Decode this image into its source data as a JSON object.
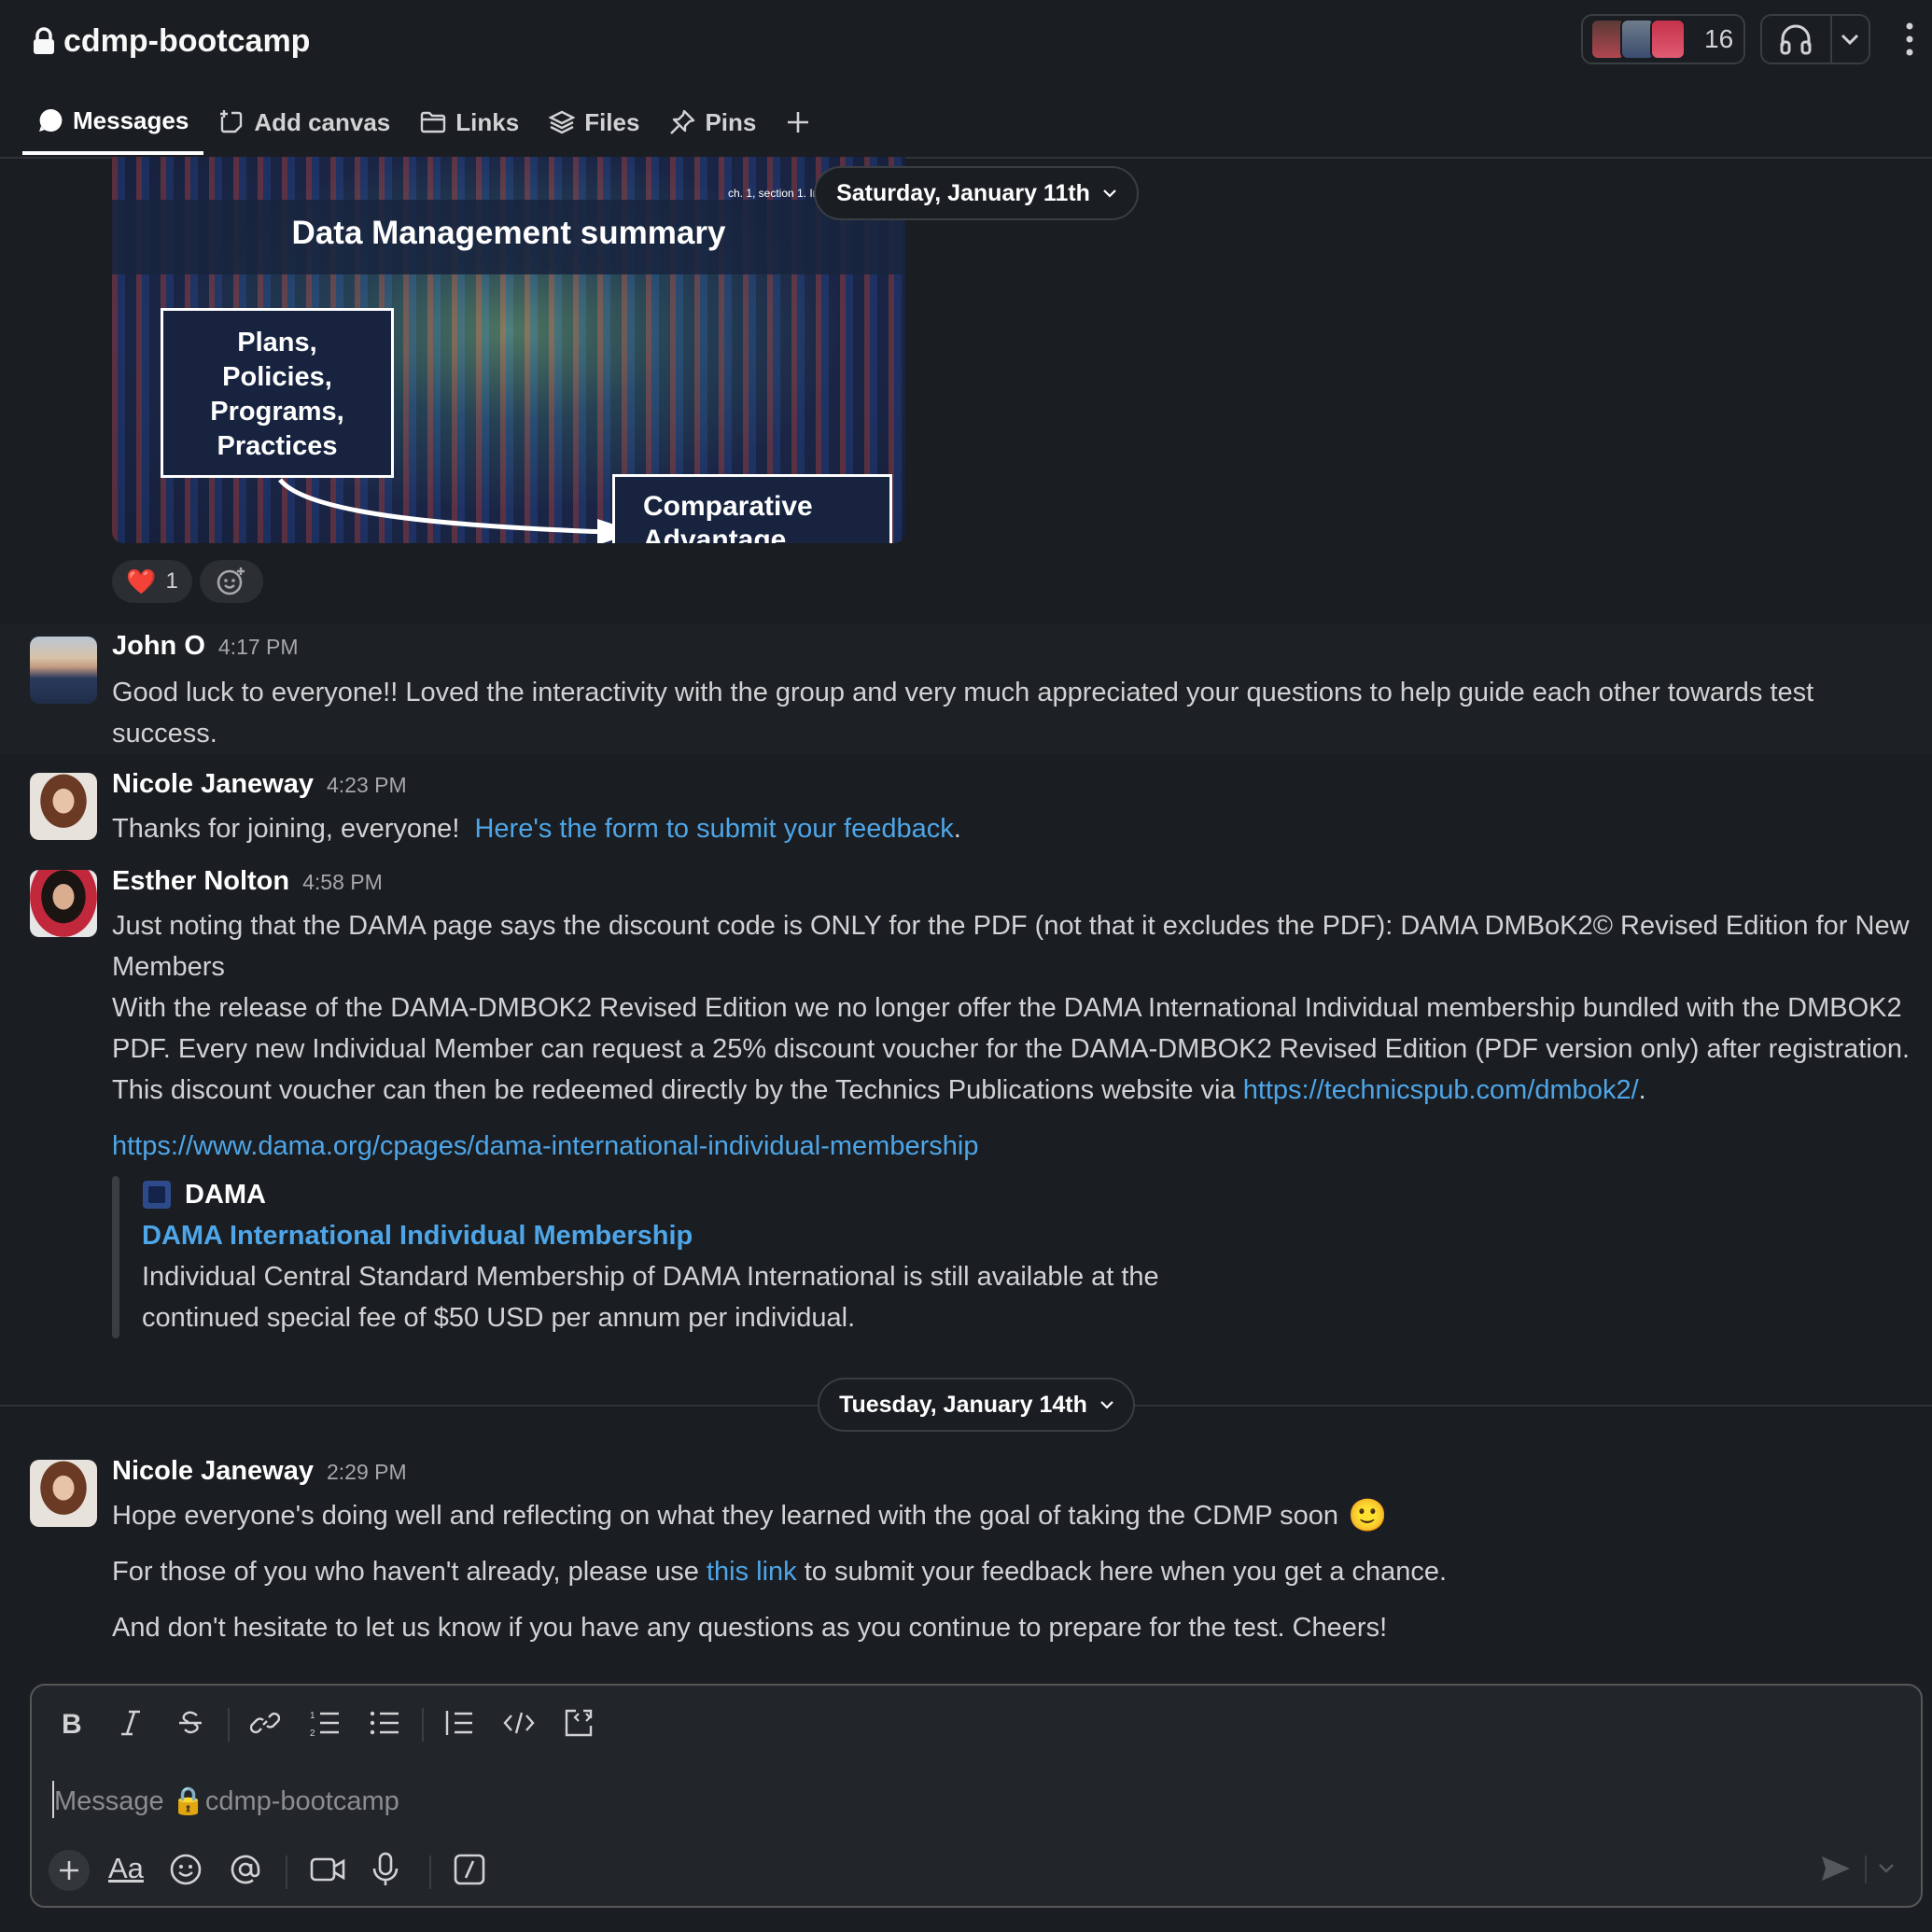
{
  "header": {
    "channel_name": "cdmp-bootcamp",
    "member_count": "16"
  },
  "tabs": [
    {
      "label": "Messages",
      "icon": "message-bubble-icon",
      "active": true
    },
    {
      "label": "Add canvas",
      "icon": "canvas-icon"
    },
    {
      "label": "Links",
      "icon": "folder-icon"
    },
    {
      "label": "Files",
      "icon": "layers-icon"
    },
    {
      "label": "Pins",
      "icon": "pin-icon"
    }
  ],
  "image_attachment": {
    "title": "Data Management summary",
    "corner_text": "ch. 1, section 1. In",
    "box1": [
      "Plans,",
      "Policies,",
      "Programs,",
      "Practices"
    ],
    "box2": "Comparative Advantage"
  },
  "reactions": [
    {
      "emoji": "❤️",
      "count": "1"
    }
  ],
  "date_dividers": [
    "Saturday, January 11th",
    "Tuesday, January 14th"
  ],
  "messages": [
    {
      "author": "John O",
      "time": "4:17 PM",
      "text": "Good luck to everyone!!  Loved the interactivity with the group and very much appreciated your questions to help guide each other towards test success."
    },
    {
      "author": "Nicole Janeway",
      "time": "4:23 PM",
      "text": "Thanks for joining, everyone!  ",
      "link": "Here's the form to submit your feedback",
      "after": "."
    },
    {
      "author": "Esther Nolton",
      "time": "4:58 PM",
      "p1": "Just noting that the DAMA page says the discount code is ONLY for the PDF (not that it excludes the PDF): DAMA DMBoK2© Revised Edition for New Members",
      "p2": "With the release of the DAMA-DMBOK2 Revised Edition we no longer offer the DAMA International Individual membership bundled with the DMBOK2 PDF. Every new Individual Member can request a 25% discount voucher for the DAMA-DMBOK2 Revised Edition (PDF version only) after registration. This discount voucher can then be redeemed directly by the Technics Publications website via ",
      "p2_link": "https://technicspub.com/dmbok2/",
      "p2_after": ".",
      "url": "https://www.dama.org/cpages/dama-international-individual-membership",
      "unfurl": {
        "site": "DAMA",
        "title": "DAMA International Individual Membership",
        "desc": "Individual Central Standard Membership of DAMA International is still available at the continued special fee of $50 USD per annum per individual."
      }
    },
    {
      "author": "Nicole Janeway",
      "time": "2:29 PM",
      "p1": "Hope everyone's doing well and reflecting on what they learned with the goal of taking the CDMP soon",
      "emoji": "🙂",
      "p2_before": "For those of you who haven't already, please use ",
      "p2_link": "this link",
      "p2_after": " to submit your feedback here when you get a chance.",
      "p3": "And don't hesitate to let us know if you have any questions as you continue to prepare for the test.  Cheers!"
    }
  ],
  "composer": {
    "placeholder": "Message 🔒cdmp-bootcamp",
    "aa_label": "Aa"
  },
  "colors": {
    "background": "#1a1d21",
    "link": "#4ea6e8",
    "text": "#d1d2d3"
  }
}
